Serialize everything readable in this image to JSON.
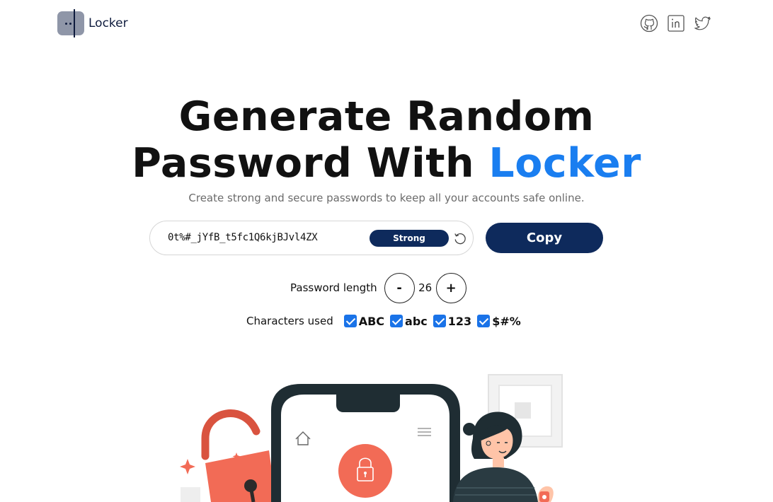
{
  "brand": {
    "name": "Locker"
  },
  "socials": [
    {
      "icon": "github-icon"
    },
    {
      "icon": "linkedin-icon"
    },
    {
      "icon": "twitter-icon"
    }
  ],
  "hero": {
    "title_line1": "Generate Random",
    "title_line2_prefix": "Password With ",
    "title_line2_accent": "Locker",
    "subtitle": "Create strong and secure passwords to keep all your accounts safe online."
  },
  "password": {
    "value": "0t%#_jYfB_t5fc1Q6kjBJvl4ZX",
    "strength": "Strong",
    "refresh_icon": "refresh-icon"
  },
  "copy_label": "Copy",
  "length": {
    "label": "Password length",
    "decrement": "-",
    "value": "26",
    "increment": "+"
  },
  "characters": {
    "label": "Characters used",
    "options": [
      {
        "label": "ABC",
        "checked": true
      },
      {
        "label": "abc",
        "checked": true
      },
      {
        "label": "123",
        "checked": true
      },
      {
        "label": "$#%",
        "checked": true
      }
    ]
  },
  "colors": {
    "navy": "#0e2a5c",
    "accent": "#1a7ef0",
    "checkbox": "#1a73e8",
    "illustration_coral": "#f26b56"
  }
}
